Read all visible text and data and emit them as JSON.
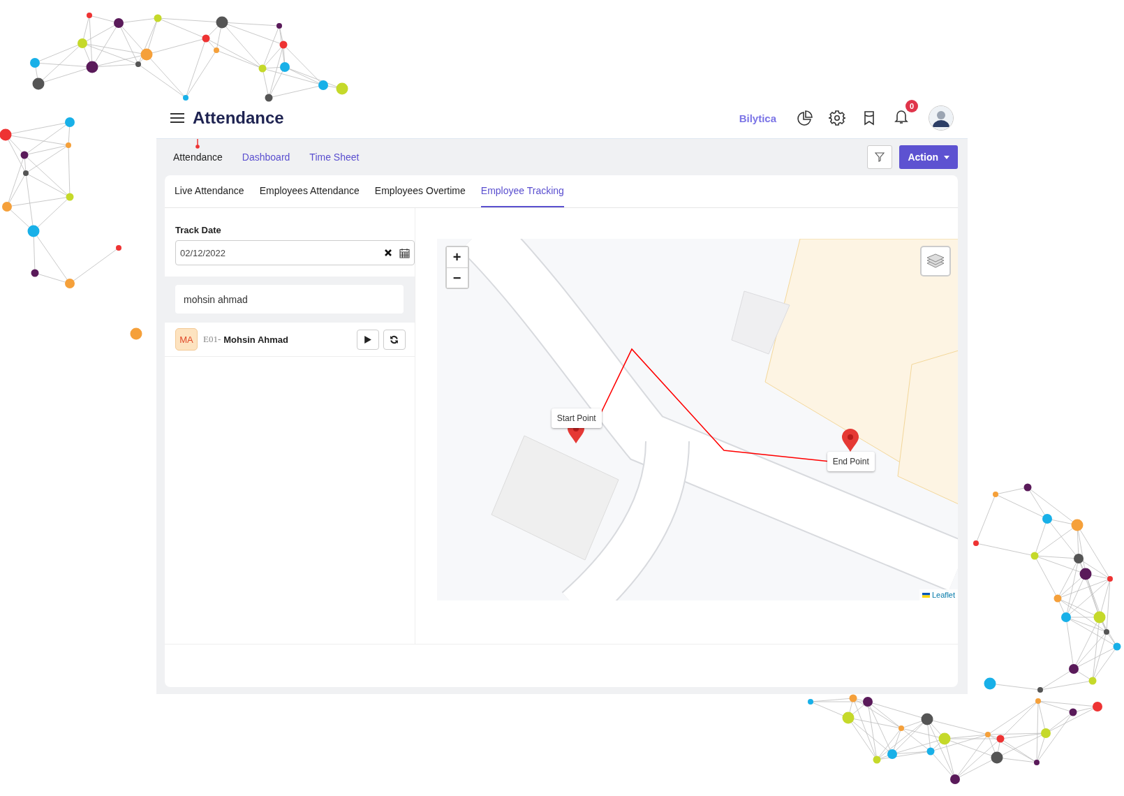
{
  "header": {
    "title": "Attendance",
    "brand": "Bilytica",
    "notification_count": "0"
  },
  "nav": [
    {
      "label": "Attendance",
      "selected": true
    },
    {
      "label": "Dashboard",
      "selected": false
    },
    {
      "label": "Time Sheet",
      "selected": false
    }
  ],
  "toolbar": {
    "action_button": "Action"
  },
  "tabs": [
    {
      "label": "Live Attendance",
      "selected": false
    },
    {
      "label": "Employees Attendance",
      "selected": false
    },
    {
      "label": "Employees Overtime",
      "selected": false
    },
    {
      "label": "Employee Tracking",
      "selected": true
    }
  ],
  "track_date": {
    "label": "Track Date",
    "value": "02/12/2022"
  },
  "search": {
    "value": "mohsin ahmad"
  },
  "employees": [
    {
      "initials": "MA",
      "code": "E01-",
      "name": "Mohsin Ahmad"
    }
  ],
  "map": {
    "zoom_in": "+",
    "zoom_out": "−",
    "markers": [
      {
        "label": "Start Point"
      },
      {
        "label": "End Point"
      }
    ],
    "attribution": "Leaflet"
  }
}
